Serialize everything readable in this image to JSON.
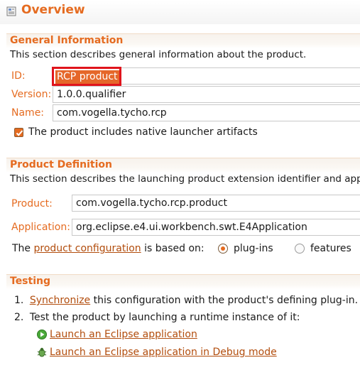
{
  "header": {
    "title": "Overview",
    "icon": "form-page-icon"
  },
  "general_information": {
    "title": "General Information",
    "description": "This section describes general information about the product.",
    "id_label": "ID:",
    "id_value": "RCP product",
    "version_label": "Version:",
    "version_value": "1.0.0.qualifier",
    "name_label": "Name:",
    "name_value": "com.vogella.tycho.rcp",
    "launcher_checkbox": {
      "label": "The product includes native launcher artifacts",
      "checked": true
    }
  },
  "product_definition": {
    "title": "Product Definition",
    "description": "This section describes the launching product extension identifier and appli",
    "product_label": "Product:",
    "product_value": "com.vogella.tycho.rcp.product",
    "application_label": "Application:",
    "application_value": "org.eclipse.e4.ui.workbench.swt.E4Application",
    "based_on": {
      "prefix": "The",
      "link": "product configuration",
      "suffix": "is based on:"
    },
    "options": [
      {
        "label": "plug-ins",
        "selected": true
      },
      {
        "label": "features",
        "selected": false
      }
    ]
  },
  "testing": {
    "title": "Testing",
    "step1": {
      "number": "1.",
      "link": "Synchronize",
      "text": "this configuration with the product's defining plug-in."
    },
    "step2": {
      "number": "2.",
      "text": "Test the product by launching a runtime instance of it:"
    },
    "launch_links": [
      {
        "label": "Launch an Eclipse application",
        "icon": "run-icon"
      },
      {
        "label": "Launch an Eclipse application in Debug mode",
        "icon": "debug-icon"
      }
    ]
  },
  "colors": {
    "accent": "#e56b20",
    "link": "#b24d0d",
    "highlight_border": "#e0141c"
  }
}
